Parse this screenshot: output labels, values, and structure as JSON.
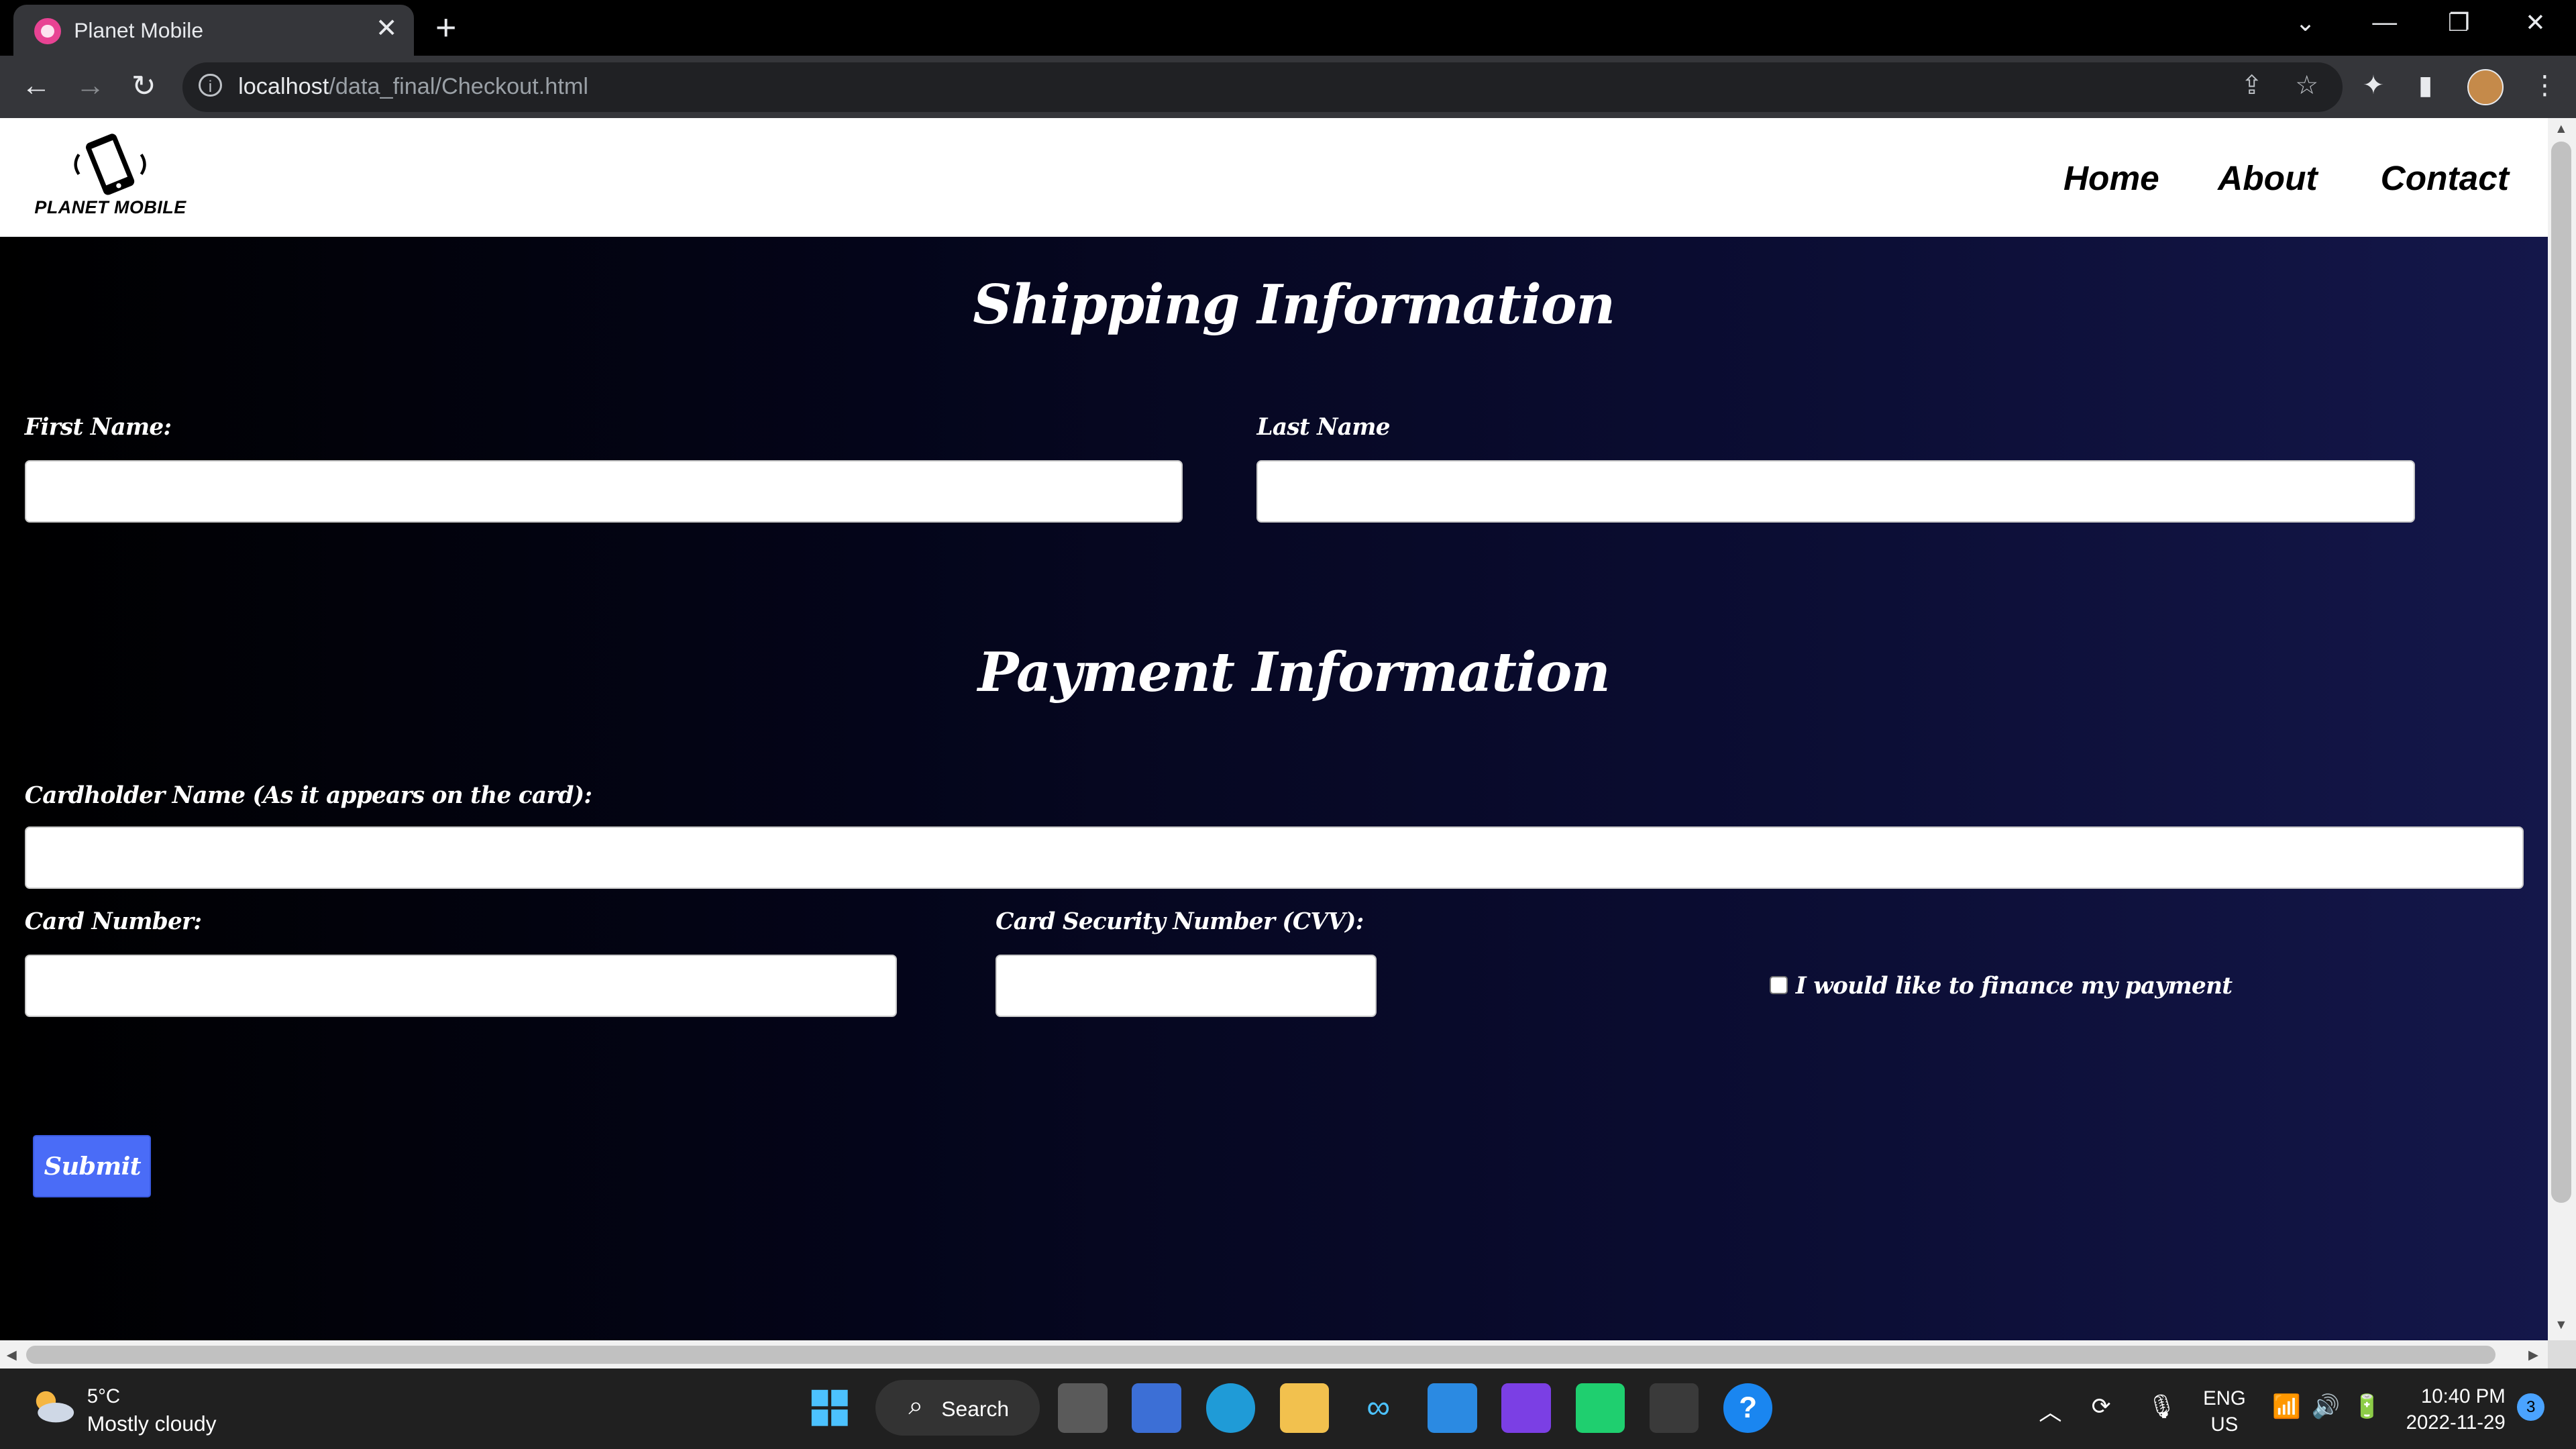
{
  "browser": {
    "tab_title": "Planet Mobile",
    "url_host": "localhost",
    "url_path": "/data_final/Checkout.html"
  },
  "site": {
    "logo_text": "PLANET MOBILE",
    "nav": [
      "Home",
      "About",
      "Contact"
    ]
  },
  "shipping": {
    "title": "Shipping Information",
    "first_name_label": "First Name:",
    "last_name_label": "Last Name",
    "first_name_value": "",
    "last_name_value": ""
  },
  "payment": {
    "title": "Payment Information",
    "cardholder_label": "Cardholder Name (As it appears on the card):",
    "card_number_label": "Card Number:",
    "cvv_label": "Card Security Number (CVV):",
    "finance_label": "I would like to finance my payment",
    "finance_checked": false,
    "submit_label": "Submit"
  },
  "taskbar": {
    "weather_temp": "5°C",
    "weather_desc": "Mostly cloudy",
    "search_label": "Search",
    "lang_line1": "ENG",
    "lang_line2": "US",
    "time": "10:40 PM",
    "date": "2022-11-29",
    "notification_count": "3"
  },
  "colors": {
    "submit_bg": "#4a6cf7",
    "gradient_end": "#14174a"
  }
}
